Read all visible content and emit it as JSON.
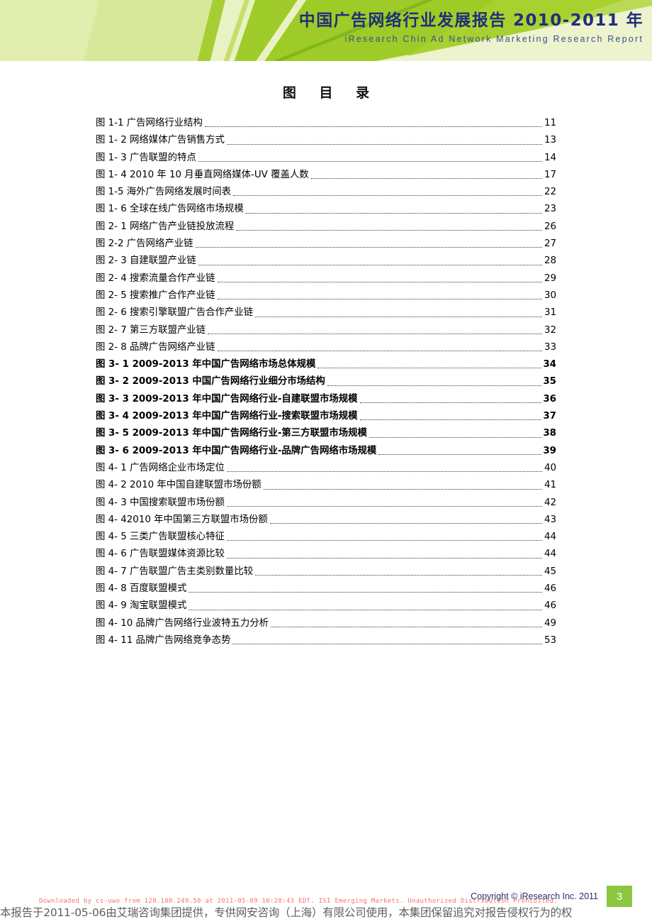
{
  "header": {
    "title": "中国广告网络行业发展报告 2010-2011 年",
    "subtitle": "iResearch Chin Ad Network Marketing Research Report",
    "accent_color": "#8cc63e",
    "title_color": "#1f2f7a"
  },
  "page_title": "图 目 录",
  "toc": {
    "entries": [
      {
        "label": "图 1-1 广告网络行业结构",
        "page": "11",
        "bold": false
      },
      {
        "label": "图 1- 2 网络媒体广告销售方式",
        "page": "13",
        "bold": false
      },
      {
        "label": "图 1- 3 广告联盟的特点",
        "page": "14",
        "bold": false
      },
      {
        "label": "图 1- 4 2010 年 10 月垂直网络媒体-UV 覆盖人数",
        "page": "17",
        "bold": false
      },
      {
        "label": "图 1-5  海外广告网络发展时间表",
        "page": "22",
        "bold": false
      },
      {
        "label": "图 1- 6 全球在线广告网络市场规模",
        "page": "23",
        "bold": false
      },
      {
        "label": "图 2- 1 网络广告产业链投放流程",
        "page": "26",
        "bold": false
      },
      {
        "label": "图 2-2  广告网络产业链",
        "page": "27",
        "bold": false
      },
      {
        "label": "图 2- 3  自建联盟产业链",
        "page": "28",
        "bold": false
      },
      {
        "label": "图 2- 4  搜索流量合作产业链",
        "page": "29",
        "bold": false
      },
      {
        "label": "图 2- 5 搜索推广合作产业链",
        "page": "30",
        "bold": false
      },
      {
        "label": "图 2- 6  搜索引擎联盟广告合作产业链",
        "page": "31",
        "bold": false
      },
      {
        "label": "图 2- 7  第三方联盟产业链",
        "page": "32",
        "bold": false
      },
      {
        "label": "图 2- 8  品牌广告网络产业链",
        "page": "33",
        "bold": false
      },
      {
        "label": "图 3- 1 2009-2013 年中国广告网络市场总体规模",
        "page": "34",
        "bold": true
      },
      {
        "label": "图 3- 2 2009-2013 中国广告网络行业细分市场结构",
        "page": "35",
        "bold": true
      },
      {
        "label": "图 3- 3 2009-2013 年中国广告网络行业-自建联盟市场规模",
        "page": "36",
        "bold": true
      },
      {
        "label": "图 3- 4 2009-2013 年中国广告网络行业-搜索联盟市场规模",
        "page": "37",
        "bold": true
      },
      {
        "label": "图 3- 5 2009-2013 年中国广告网络行业-第三方联盟市场规模",
        "page": "38",
        "bold": true
      },
      {
        "label": "图 3- 6 2009-2013 年中国广告网络行业-品牌广告网络市场规模",
        "page": "39",
        "bold": true
      },
      {
        "label": "图 4- 1  广告网络企业市场定位",
        "page": "40",
        "bold": false
      },
      {
        "label": "图 4- 2 2010 年中国自建联盟市场份额",
        "page": "41",
        "bold": false
      },
      {
        "label": "图 4- 3 中国搜索联盟市场份额",
        "page": "42",
        "bold": false
      },
      {
        "label": "图 4- 42010 年中国第三方联盟市场份额",
        "page": "43",
        "bold": false
      },
      {
        "label": "图 4- 5 三类广告联盟核心特征",
        "page": "44",
        "bold": false
      },
      {
        "label": "图 4- 6 广告联盟媒体资源比较",
        "page": "44",
        "bold": false
      },
      {
        "label": "图 4- 7 广告联盟广告主类别数量比较",
        "page": "45",
        "bold": false
      },
      {
        "label": "图 4- 8 百度联盟模式",
        "page": "46",
        "bold": false
      },
      {
        "label": "图 4- 9 淘宝联盟模式",
        "page": "46",
        "bold": false
      },
      {
        "label": "图 4- 10 品牌广告网络行业波特五力分析",
        "page": "49",
        "bold": false
      },
      {
        "label": "图 4- 11  品牌广告网络竞争态势",
        "page": "53",
        "bold": false
      }
    ]
  },
  "footer": {
    "copyright": "Copyright © iResearch Inc. 2011",
    "page_number": "3"
  },
  "overlay": {
    "disclaimer": "本报告于2011-05-06由艾瑞咨询集团提供，专供网安咨询（上海）有限公司使用，本集团保留追究对报告侵权行为的权",
    "watermark": "Downloaded by cs-uwo from 128.100.249.50 at 2011-05-09 16:28:43 EDT. ISI Emerging Markets. Unauthorized Distribution Prohibited."
  }
}
